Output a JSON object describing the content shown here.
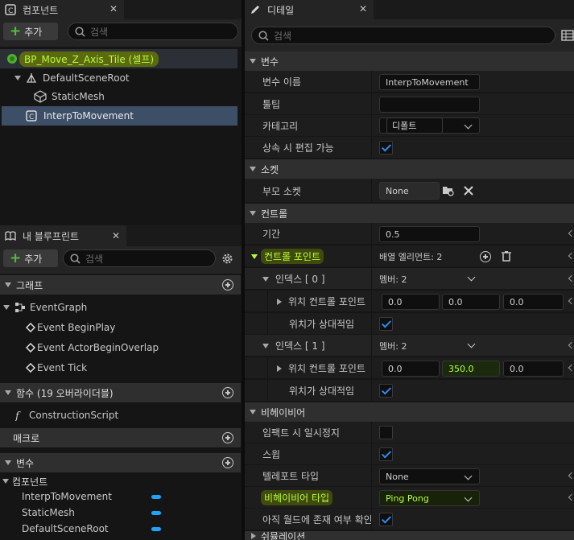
{
  "components_panel": {
    "tab_title": "컴포넌트",
    "add_label": "추가",
    "search_placeholder": "검색",
    "tree": [
      {
        "label": "BP_Move_Z_Axis_Tile (셀프)"
      },
      {
        "label": "DefaultSceneRoot"
      },
      {
        "label": "StaticMesh"
      },
      {
        "label": "InterpToMovement"
      }
    ]
  },
  "blueprint_panel": {
    "tab_title": "내 블루프린트",
    "add_label": "추가",
    "search_placeholder": "검색",
    "graph_header": "그래프",
    "graph_items": [
      "EventGraph",
      "Event BeginPlay",
      "Event ActorBeginOverlap",
      "Event Tick"
    ],
    "functions_header": "함수 (19 오버라이더블)",
    "function_items": [
      "ConstructionScript"
    ],
    "macros_header": "매크로",
    "variables_header": "변수",
    "components_sub": "컴포넌트",
    "variable_items": [
      "InterpToMovement",
      "StaticMesh",
      "DefaultSceneRoot"
    ]
  },
  "details_panel": {
    "tab_title": "디테일",
    "search_placeholder": "검색",
    "variables_section": "변수",
    "var_name_label": "변수 이름",
    "var_name_value": "InterpToMovement",
    "tooltip_label": "툴팁",
    "tooltip_value": "",
    "category_label": "카테고리",
    "category_value": "디폴트",
    "editable_label": "상속 시 편집 가능",
    "socket_section": "소켓",
    "parent_socket_label": "부모 소켓",
    "parent_socket_value": "None",
    "control_section": "컨트롤",
    "duration_label": "기간",
    "duration_value": "0.5",
    "control_points_label": "컨트롤 포인트",
    "control_points_value": "배열 엘리먼트: 2",
    "index0_label": "인덱스 [ 0 ]",
    "index0_value": "멤버: 2",
    "pos_cp_label": "위치 컨트롤 포인트",
    "index0_x": "0.0",
    "index0_y": "0.0",
    "index0_z": "0.0",
    "relative_label": "위치가 상대적임",
    "index1_label": "인덱스 [ 1 ]",
    "index1_value": "멤버: 2",
    "index1_x": "0.0",
    "index1_y": "350.0",
    "index1_z": "0.0",
    "behaviour_section": "비헤이비어",
    "pause_on_impact_label": "임팩트 시 일시정지",
    "sweep_label": "스윕",
    "teleport_label": "텔레포트 타입",
    "teleport_value": "None",
    "behaviour_type_label": "비헤이비어 타입",
    "behaviour_type_value": "Ping Pong",
    "check_world_label": "아직 월드에 존재 여부 확인",
    "next_section": "쉬뮬레이션"
  },
  "colors": {
    "accent_blue": "#2a8cf0",
    "highlight_green": "#b8ff3a",
    "selected_row": "#3d4f66"
  }
}
